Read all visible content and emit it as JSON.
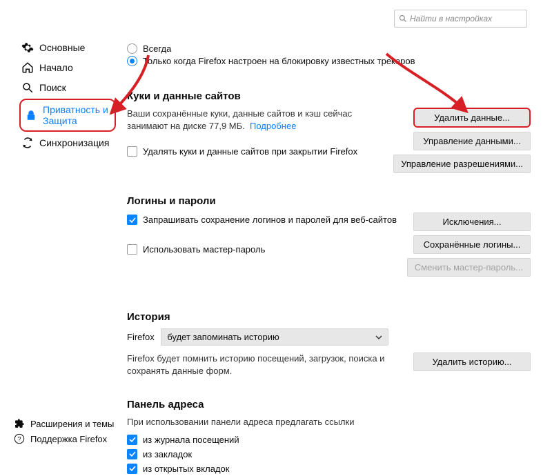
{
  "search": {
    "placeholder": "Найти в настройках"
  },
  "sidebar": {
    "items": [
      {
        "label": "Основные"
      },
      {
        "label": "Начало"
      },
      {
        "label": "Поиск"
      },
      {
        "label": "Приватность и Защита"
      },
      {
        "label": "Синхронизация"
      }
    ]
  },
  "sidebar_bottom": {
    "items": [
      {
        "label": "Расширения и темы"
      },
      {
        "label": "Поддержка Firefox"
      }
    ]
  },
  "tracking": {
    "opt_always": "Всегда",
    "opt_known": "Только когда Firefox настроен на блокировку известных трекеров"
  },
  "cookies": {
    "title": "Куки и данные сайтов",
    "desc_a": "Ваши сохранённые куки, данные сайтов и кэш сейчас занимают на диске ",
    "size": "77,9 МБ.",
    "more": "Подробнее",
    "clear_on_close": "Удалять куки и данные сайтов при закрытии Firefox",
    "btn_clear": "Удалить данные...",
    "btn_manage": "Управление данными...",
    "btn_perm": "Управление разрешениями..."
  },
  "logins": {
    "title": "Логины и пароли",
    "ask": "Запрашивать сохранение логинов и паролей для веб-сайтов",
    "use_master": "Использовать мастер-пароль",
    "btn_exc": "Исключения...",
    "btn_saved": "Сохранённые логины...",
    "btn_change": "Сменить мастер-пароль..."
  },
  "history": {
    "title": "История",
    "prefix": "Firefox",
    "select": "будет запоминать историю",
    "desc": "Firefox будет помнить историю посещений, загрузок, поиска и сохранять данные форм.",
    "btn_clear": "Удалить историю..."
  },
  "addressbar": {
    "title": "Панель адреса",
    "desc": "При использовании панели адреса предлагать ссылки",
    "opt_history": "из журнала посещений",
    "opt_bookmarks": "из закладок",
    "opt_tabs": "из открытых вкладок"
  }
}
